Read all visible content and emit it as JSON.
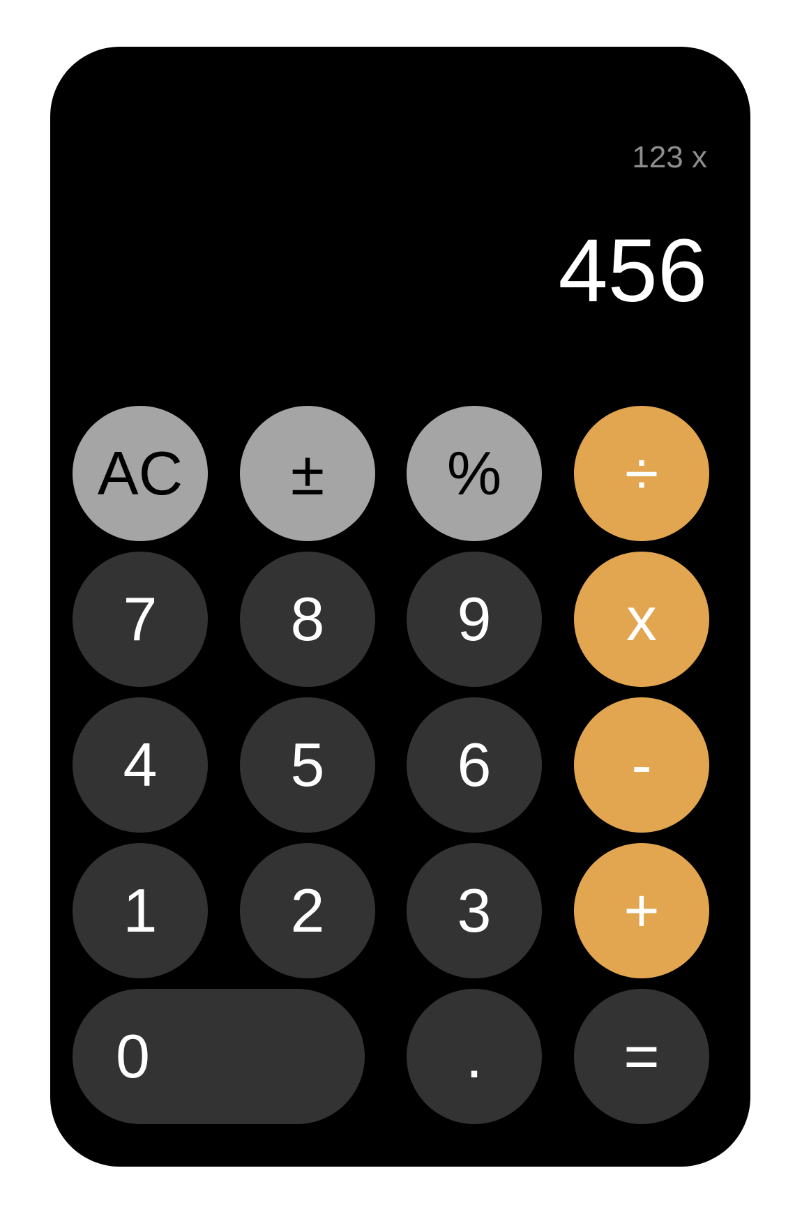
{
  "display": {
    "expression": "123 x",
    "value": "456"
  },
  "keys": {
    "clear": "AC",
    "sign": "±",
    "percent": "%",
    "divide": "÷",
    "seven": "7",
    "eight": "8",
    "nine": "9",
    "multiply": "x",
    "four": "4",
    "five": "5",
    "six": "6",
    "subtract": "-",
    "one": "1",
    "two": "2",
    "three": "3",
    "add": "+",
    "zero": "0",
    "decimal": ".",
    "equals": "="
  },
  "colors": {
    "background": "#000000",
    "function_key": "#a5a5a5",
    "number_key": "#333333",
    "operator_key": "#e2a550",
    "expression_text": "#8e8e8e"
  }
}
